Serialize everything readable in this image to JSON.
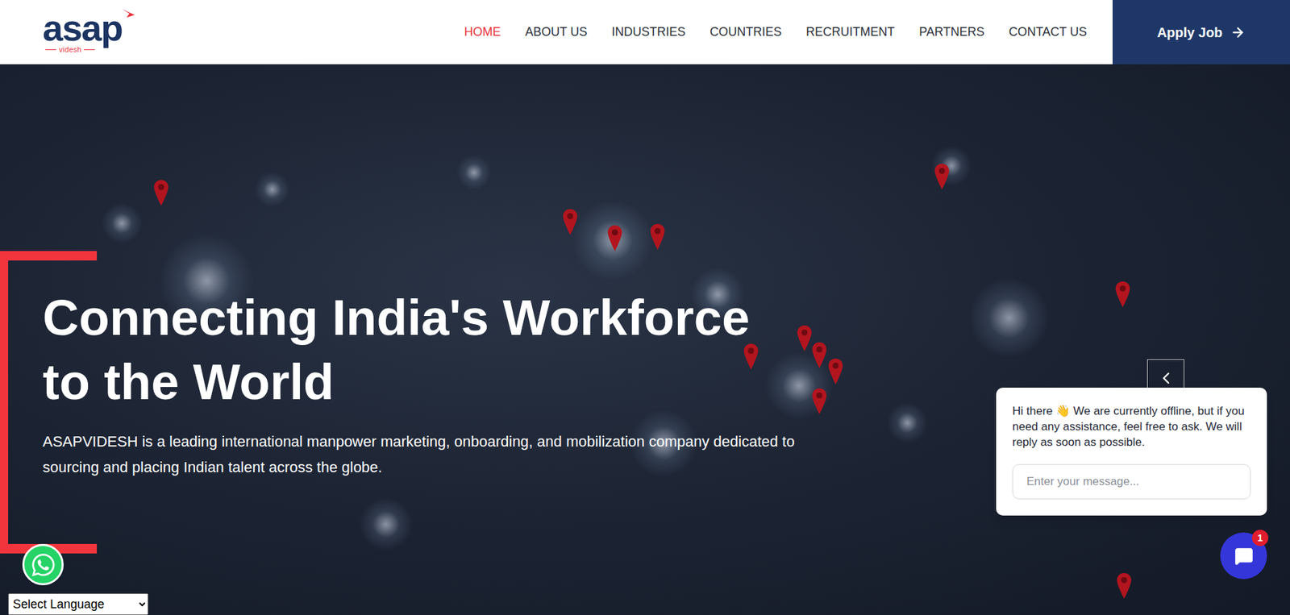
{
  "header": {
    "logo": {
      "name": "asap",
      "tagline": "videsh"
    },
    "nav": [
      {
        "label": "HOME",
        "selected": true
      },
      {
        "label": "ABOUT US",
        "selected": false
      },
      {
        "label": "INDUSTRIES",
        "selected": false
      },
      {
        "label": "COUNTRIES",
        "selected": false
      },
      {
        "label": "RECRUITMENT",
        "selected": false
      },
      {
        "label": "PARTNERS",
        "selected": false
      },
      {
        "label": "CONTACT US",
        "selected": false
      }
    ],
    "cta": {
      "label": "Apply Job"
    }
  },
  "hero": {
    "title_lines": [
      "Connecting India's Workforce",
      "to the World"
    ],
    "description": "ASAPVIDESH is a leading international manpower marketing, onboarding, and mobilization company dedicated to sourcing and placing Indian talent across the globe."
  },
  "chat": {
    "message": "Hi there 👋 We are currently offline, but if you need any assistance, feel free to ask. We will reply as soon as possible.",
    "placeholder": "Enter your message...",
    "badge": "1"
  },
  "language_select": {
    "value": "Select Language"
  }
}
